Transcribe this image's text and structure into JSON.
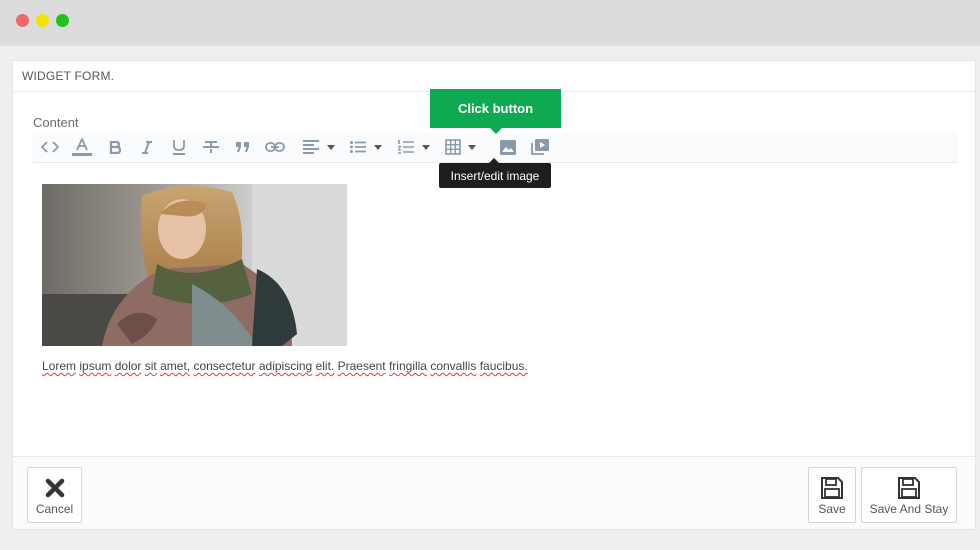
{
  "window": {
    "controls": [
      "close",
      "minimize",
      "maximize"
    ]
  },
  "panel": {
    "title": "WIDGET FORM."
  },
  "form": {
    "content_label": "Content"
  },
  "toolbar": {
    "buttons": [
      "source-code-icon",
      "text-color-icon",
      "bold-icon",
      "italic-icon",
      "underline-icon",
      "strikethrough-icon",
      "blockquote-icon",
      "link-icon",
      "align-left-icon",
      "bullet-list-icon",
      "numbered-list-icon",
      "table-icon",
      "image-icon",
      "media-icon"
    ]
  },
  "editor": {
    "body_text_words": [
      "Lorem",
      "ipsum",
      "dolor",
      "sit",
      "amet,",
      "consectetur",
      "adipiscing",
      "elit.",
      "Praesent",
      "fringilla",
      "convallis",
      "faucibus."
    ]
  },
  "callout": {
    "label": "Click button",
    "color": "#0ea951"
  },
  "tooltip": {
    "label": "Insert/edit image"
  },
  "footer": {
    "cancel_label": "Cancel",
    "save_label": "Save",
    "save_and_stay_label": "Save And Stay"
  }
}
